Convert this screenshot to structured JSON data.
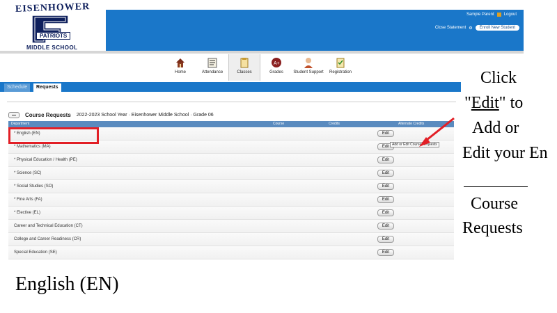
{
  "school": {
    "arc_text": "EISENHOWER",
    "banner_text": "PATRIOTS",
    "bottom_text": "MIDDLE SCHOOL"
  },
  "header": {
    "parent_name": "Sample Parent",
    "logout_label": "Logout",
    "close_statement": "Close Statement",
    "enroll_button": "Enroll New Student"
  },
  "nav": {
    "items": [
      {
        "label": "Home",
        "icon": "home-icon"
      },
      {
        "label": "Attendance",
        "icon": "attendance-icon"
      },
      {
        "label": "Classes",
        "icon": "classes-icon",
        "active": true
      },
      {
        "label": "Grades",
        "icon": "grades-icon"
      },
      {
        "label": "Student Support",
        "icon": "student-support-icon"
      },
      {
        "label": "Registration",
        "icon": "registration-icon"
      }
    ]
  },
  "tabs": {
    "schedule": "Schedule",
    "requests": "Requests"
  },
  "section": {
    "title": "Course Requests",
    "subtitle": "2022-2023 School Year · Eisenhower Middle School · Grade 06"
  },
  "columns": {
    "department": "Department",
    "course": "Course",
    "credits": "Credits",
    "alternate": "Alternate Credits"
  },
  "rows": [
    {
      "label": "* English (EN)"
    },
    {
      "label": "* Mathematics (MA)"
    },
    {
      "label": "* Physical Education / Health (PE)"
    },
    {
      "label": "* Science (SC)"
    },
    {
      "label": "* Social Studies (SO)"
    },
    {
      "label": "* Fine Arts (FA)"
    },
    {
      "label": "* Elective (EL)"
    },
    {
      "label": "Career and Technical Education (CT)"
    },
    {
      "label": "College and Career Readiness (CR)"
    },
    {
      "label": "Special Education (SE)"
    }
  ],
  "edit_label": "Edit",
  "tooltip": "Add or Edit Course Requests",
  "annotation": {
    "click": "Click",
    "edit_open": "\"",
    "edit_word": "Edit",
    "edit_close": "\" to",
    "add_or": "Add or",
    "edit_your": "Edit your En",
    "course": "Course",
    "requests": "Requests",
    "english": "English    (EN)"
  },
  "colors": {
    "brand_blue": "#1a77c9",
    "navy": "#0e1f5c",
    "highlight_red": "#e21f26"
  }
}
